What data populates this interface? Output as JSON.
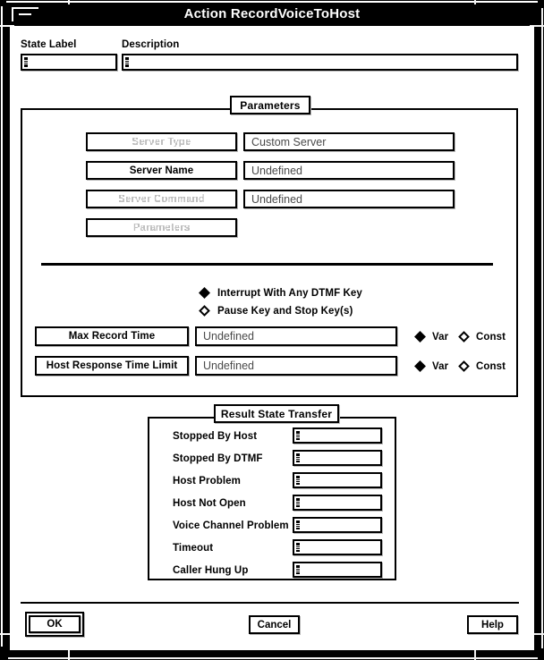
{
  "window": {
    "title": "Action RecordVoiceToHost",
    "minimize_icon": "minimize-icon"
  },
  "header": {
    "state_label_caption": "State Label",
    "state_label_value": "",
    "description_caption": "Description",
    "description_value": ""
  },
  "parameters_frame": {
    "title": "Parameters",
    "rows": [
      {
        "label": "Server Type",
        "enabled": false,
        "value": "Custom Server",
        "has_value": true
      },
      {
        "label": "Server Name",
        "enabled": true,
        "value": "Undefined",
        "has_value": true
      },
      {
        "label": "Server Command",
        "enabled": false,
        "value": "Undefined",
        "has_value": true
      },
      {
        "label": "Parameters",
        "enabled": false,
        "value": "",
        "has_value": false
      }
    ],
    "interrupt_options": [
      {
        "label": "Interrupt With Any DTMF Key",
        "selected": true
      },
      {
        "label": "Pause Key and Stop Key(s)",
        "selected": false
      }
    ],
    "time_rows": [
      {
        "label": "Max Record Time",
        "value": "Undefined",
        "var_label": "Var",
        "const_label": "Const",
        "mode": "Var"
      },
      {
        "label": "Host Response Time Limit",
        "value": "Undefined",
        "var_label": "Var",
        "const_label": "Const",
        "mode": "Var"
      }
    ]
  },
  "result_state_transfer": {
    "title": "Result State Transfer",
    "rows": [
      {
        "label": "Stopped By Host",
        "value": ""
      },
      {
        "label": "Stopped By DTMF",
        "value": ""
      },
      {
        "label": "Host Problem",
        "value": ""
      },
      {
        "label": "Host Not Open",
        "value": ""
      },
      {
        "label": "Voice Channel Problem",
        "value": ""
      },
      {
        "label": "Timeout",
        "value": ""
      },
      {
        "label": "Caller Hung Up",
        "value": ""
      }
    ]
  },
  "actions": {
    "ok": "OK",
    "cancel": "Cancel",
    "help": "Help"
  },
  "colors": {
    "frame": "#000000",
    "background": "#ffffff",
    "title_text": "#ffffff",
    "value_text": "#4a4a4a"
  }
}
